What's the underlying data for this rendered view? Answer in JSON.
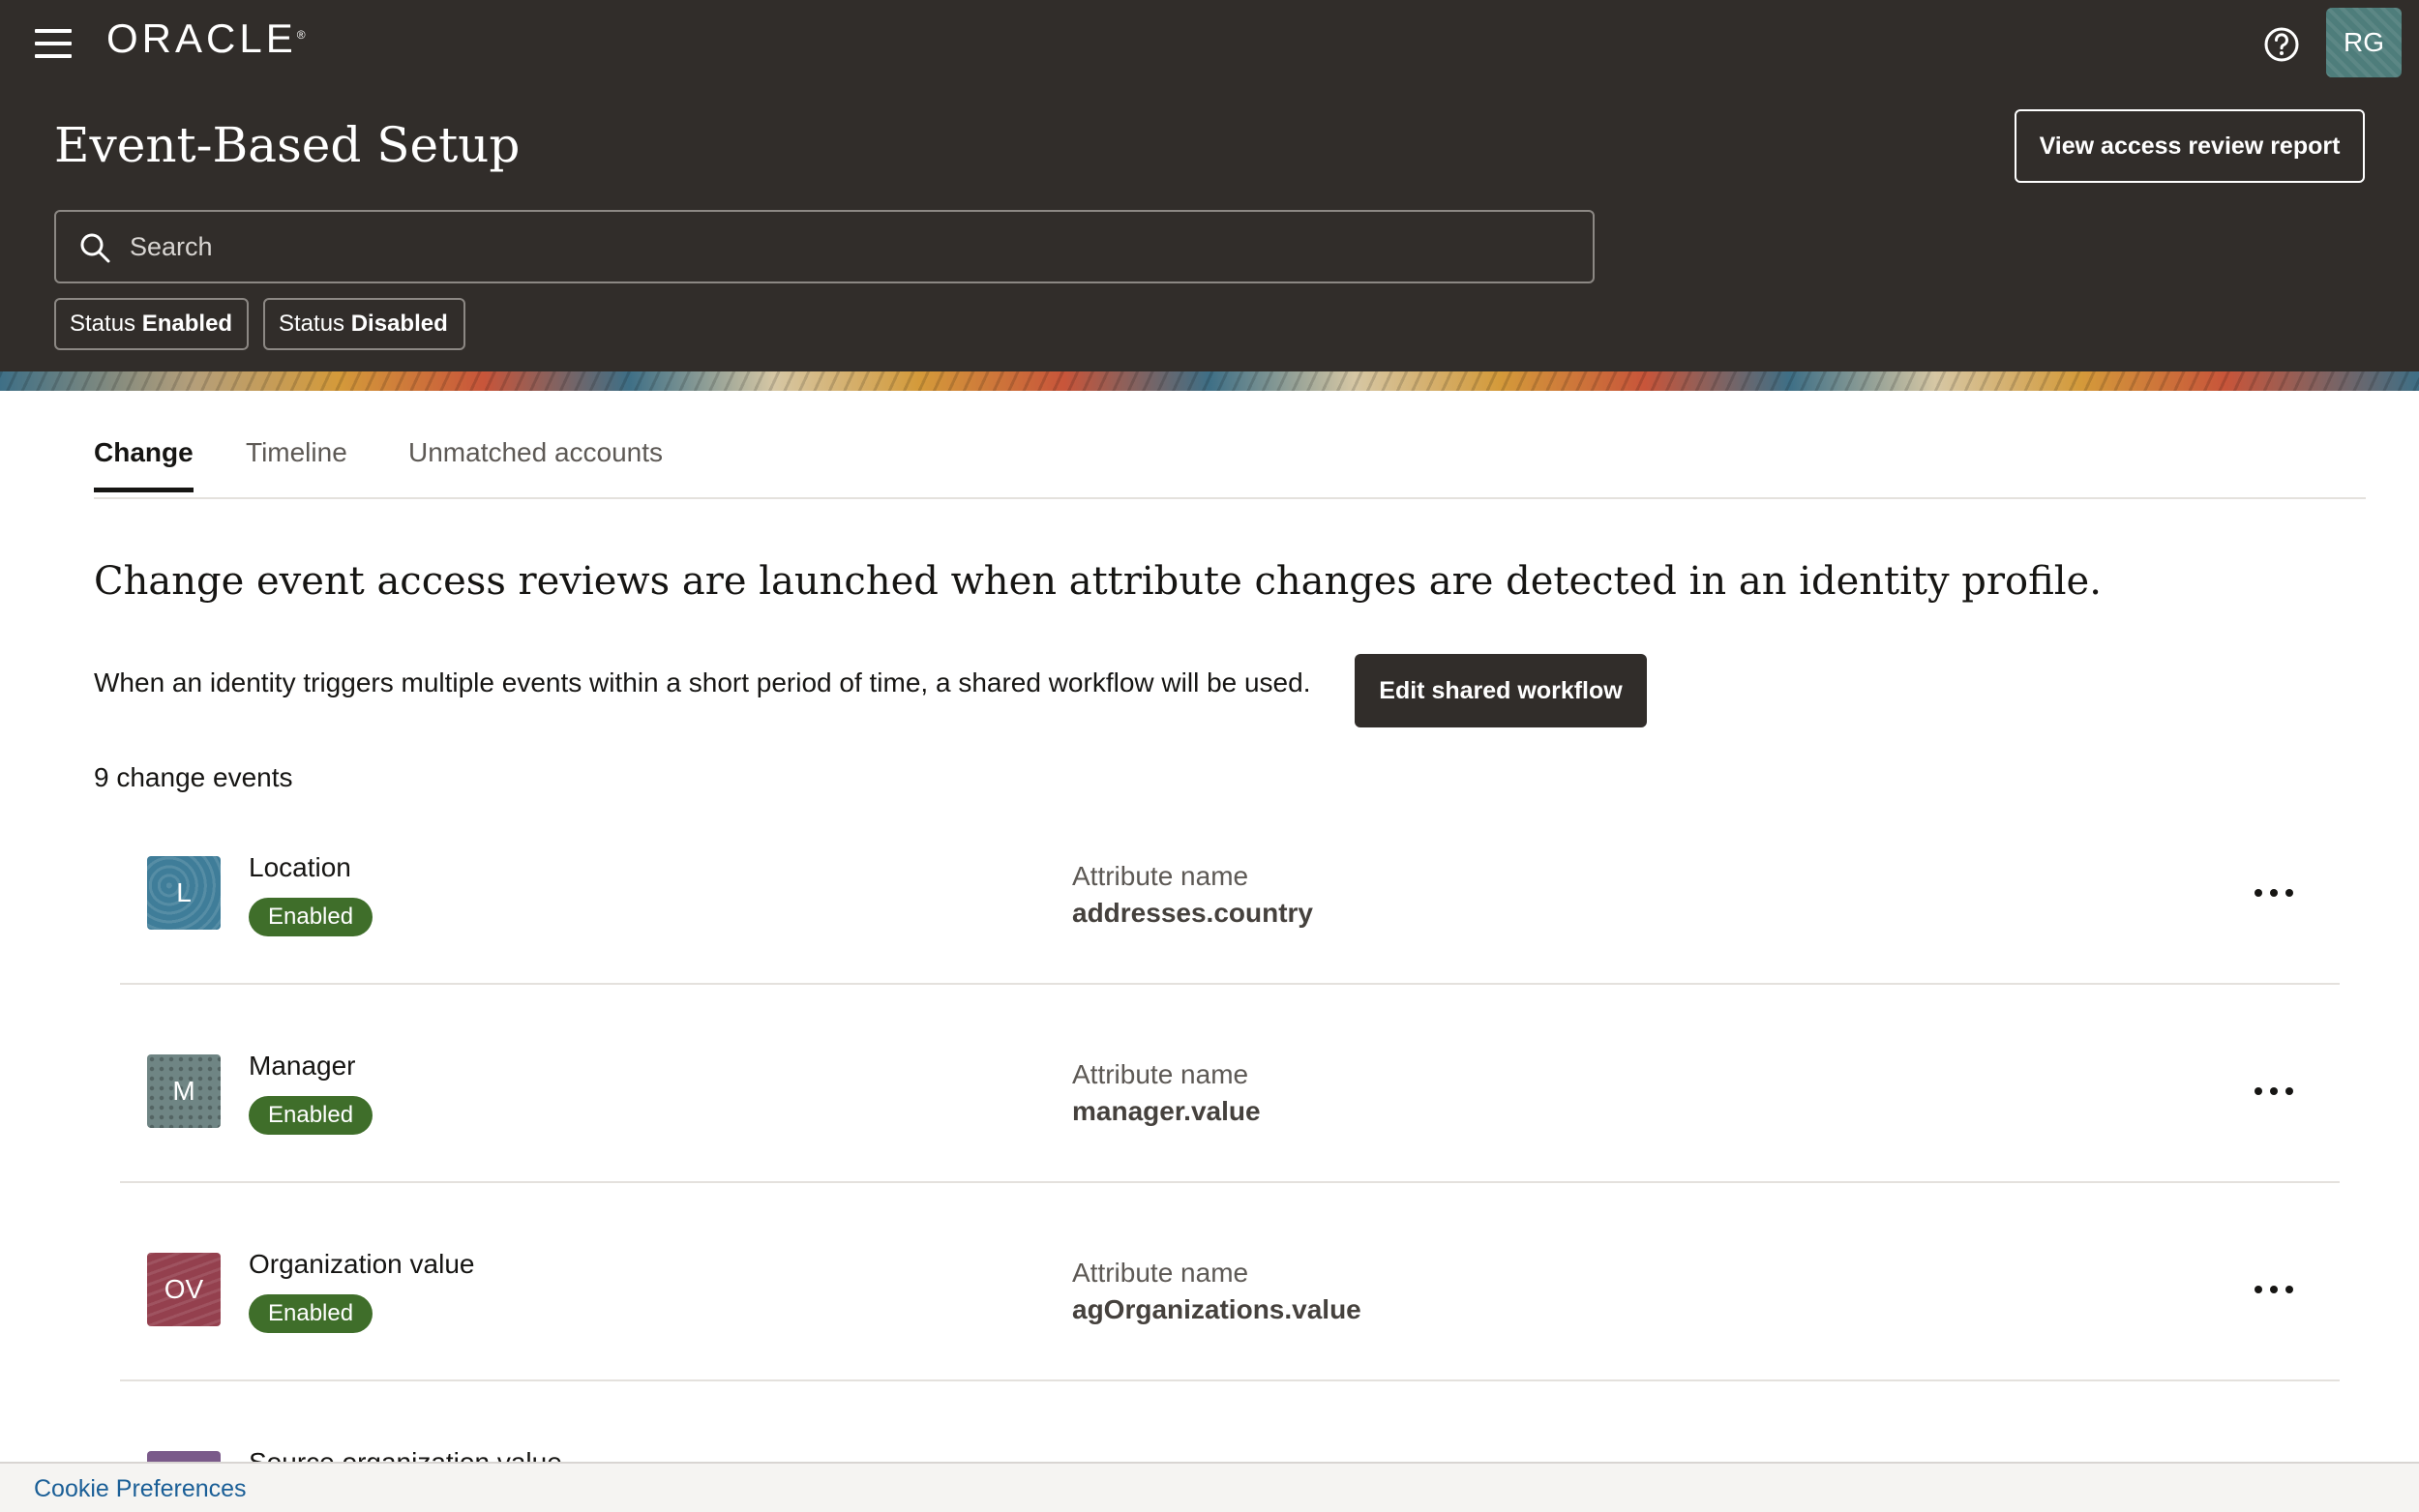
{
  "header": {
    "brand": "ORACLE",
    "brand_mark": "®",
    "avatar_initials": "RG",
    "title": "Event-Based Setup",
    "report_button": "View access review report",
    "search_placeholder": "Search",
    "filters": [
      {
        "prefix": "Status",
        "value": "Enabled"
      },
      {
        "prefix": "Status",
        "value": "Disabled"
      }
    ]
  },
  "tabs": [
    "Change",
    "Timeline",
    "Unmatched accounts"
  ],
  "active_tab": "Change",
  "content": {
    "description": "Change event access reviews are launched when attribute changes are detected in an identity profile.",
    "shared_workflow_text": "When an identity triggers multiple events within a short period of time, a shared workflow will be used.",
    "edit_button": "Edit shared workflow",
    "count_label": "9 change events"
  },
  "events": [
    {
      "initials": "L",
      "name": "Location",
      "status": "Enabled",
      "attr_label": "Attribute name",
      "attr_value": "addresses.country",
      "color": "#3f7d99"
    },
    {
      "initials": "M",
      "name": "Manager",
      "status": "Enabled",
      "attr_label": "Attribute name",
      "attr_value": "manager.value",
      "color": "#6f8584"
    },
    {
      "initials": "OV",
      "name": "Organization value",
      "status": "Enabled",
      "attr_label": "Attribute name",
      "attr_value": "agOrganizations.value",
      "color": "#94404e"
    },
    {
      "initials": "",
      "name": "Source organization value",
      "status": "",
      "attr_label": "",
      "attr_value": "",
      "color": "#7a5a8a"
    }
  ],
  "colors": {
    "header_bg": "#312d2a",
    "enabled_badge": "#3f6e2a",
    "link": "#1b5f97"
  },
  "footer": {
    "cookie_link": "Cookie Preferences"
  }
}
